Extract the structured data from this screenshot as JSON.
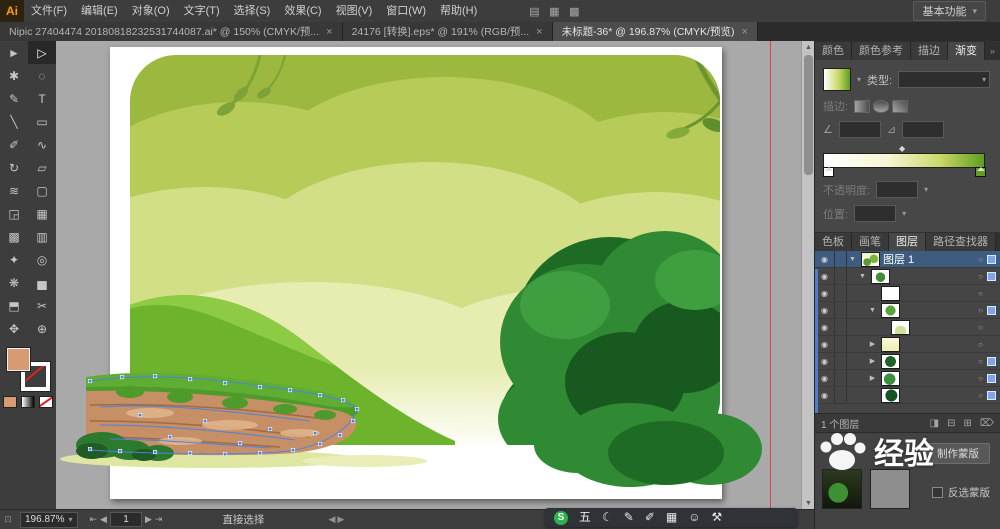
{
  "app": {
    "logo": "Ai",
    "workspace": "基本功能"
  },
  "menubar": {
    "items": [
      "文件(F)",
      "编辑(E)",
      "对象(O)",
      "文字(T)",
      "选择(S)",
      "效果(C)",
      "视图(V)",
      "窗口(W)",
      "帮助(H)"
    ]
  },
  "tabs": [
    {
      "title": "Nipic 27404474 20180818232531744087.ai* @ 150% (CMYK/预..."
    },
    {
      "title": "24176 [转换].eps* @ 191% (RGB/预..."
    },
    {
      "title": "未标题-36* @ 196.87% (CMYK/预览)"
    }
  ],
  "panels": {
    "group1": {
      "tabs": [
        "颜色",
        "颜色参考",
        "描边",
        "渐变"
      ]
    },
    "gradient": {
      "type_label": "类型:",
      "stroke_label": "描边:",
      "opacity_label": "不透明度:",
      "position_label": "位置:",
      "from": "#ffffff",
      "mid": "#cbd96a",
      "to": "#5f9e1f"
    },
    "group2": {
      "tabs": [
        "色板",
        "画笔",
        "图层",
        "路径查找器"
      ]
    },
    "layers": {
      "layer1": "图层 1",
      "status": "1 个图层"
    },
    "transparency": {
      "make_mask": "制作蒙版",
      "invert_mask": "反选蒙版"
    }
  },
  "statusbar": {
    "zoom": "196.87%",
    "artboard": "1",
    "tool": "直接选择"
  },
  "ime": {
    "logo": "S",
    "mode": "五"
  },
  "watermark": {
    "text": "经验"
  },
  "colors": {
    "selection_blue": "#4d82e0",
    "fill_swatch": "#d89a72",
    "layer_selected": "#3d5c80"
  },
  "glyphs": {
    "close": "×",
    "chev_down": "▾",
    "panel_menu": "☰",
    "collapse": "»",
    "tri_down": "▼",
    "tri_right": "▶",
    "eye": "◉",
    "target": "○",
    "diamond": "◆",
    "sel": "►",
    "dsel": "▷",
    "wand": "✱",
    "lasso": "◌",
    "pen": "✎",
    "type": "T",
    "line": "╲",
    "rect": "▭",
    "brush": "✐",
    "pencil": "∿",
    "rotate": "↻",
    "scale": "▱",
    "width": "≋",
    "ftransform": "▢",
    "shapebuilder": "◲",
    "pgrid": "▦",
    "mesh": "▩",
    "grad": "▥",
    "eyedrop": "✦",
    "blend": "◎",
    "symbol": "❋",
    "graph": "▅",
    "artboard": "⬒",
    "slice": "✂",
    "hand": "✥",
    "zoom": "⊕",
    "nav_first": "⇤",
    "nav_prev": "◀",
    "nav_next": "▶",
    "nav_last": "⇥",
    "angle": "∠",
    "aspect": "⊿",
    "moon": "☾",
    "write": "✎",
    "grid": "▦",
    "people": "☺",
    "wrench": "⚒",
    "icon_a": "▤",
    "icon_b": "▦",
    "icon_c": "▩",
    "clip": "◨",
    "sublayer": "⊟",
    "newlayer": "⊞",
    "trash": "⌦",
    "scroll_up": "▲",
    "scroll_down": "▼",
    "sb_left": "◀",
    "sb_right": "▶",
    "sb_ic": "⊡"
  }
}
